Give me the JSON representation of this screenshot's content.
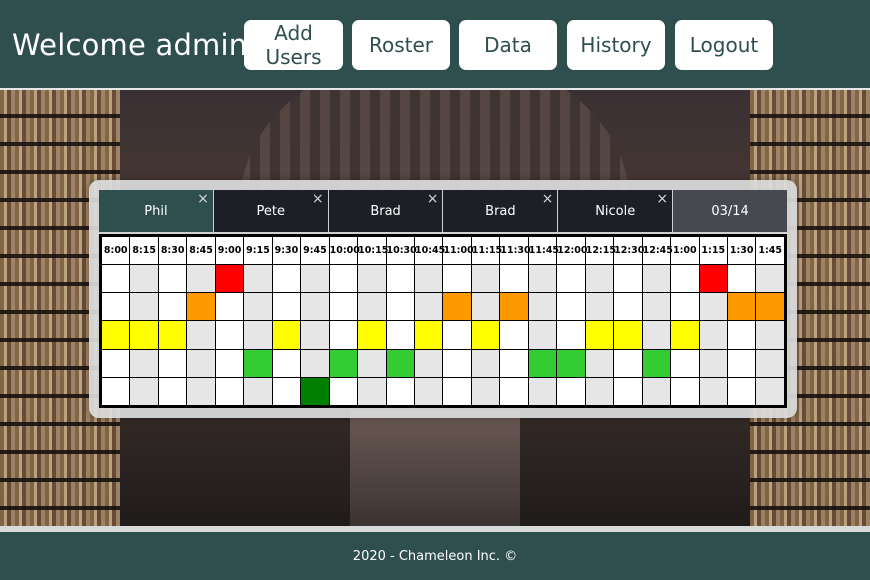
{
  "header": {
    "welcome": "Welcome admin!",
    "nav": [
      "Add Users",
      "Roster",
      "Data",
      "History",
      "Logout"
    ]
  },
  "tabs": [
    {
      "label": "Phil",
      "close": "×",
      "active": true
    },
    {
      "label": "Pete",
      "close": "×",
      "active": false
    },
    {
      "label": "Brad",
      "close": "×",
      "active": false
    },
    {
      "label": "Brad",
      "close": "×",
      "active": false
    },
    {
      "label": "Nicole",
      "close": "×",
      "active": false
    }
  ],
  "date_tab": "03/14",
  "times": [
    "8:00",
    "8:15",
    "8:30",
    "8:45",
    "9:00",
    "9:15",
    "9:30",
    "9:45",
    "10:00",
    "10:15",
    "10:30",
    "10:45",
    "11:00",
    "11:15",
    "11:30",
    "11:45",
    "12:00",
    "12:15",
    "12:30",
    "12:45",
    "1:00",
    "1:15",
    "1:30",
    "1:45"
  ],
  "colors": {
    "red": "#ff0000",
    "orange": "#ff9900",
    "yellow": "#ffff00",
    "green": "#33cc33",
    "dark_green": "#008000",
    "empty": "#ffffff",
    "empty_alt": "#e6e6e6"
  },
  "grid_rows": [
    [
      "W",
      "A",
      "W",
      "A",
      "R",
      "A",
      "W",
      "A",
      "W",
      "A",
      "W",
      "A",
      "W",
      "A",
      "W",
      "A",
      "W",
      "A",
      "W",
      "A",
      "W",
      "R",
      "W",
      "A"
    ],
    [
      "W",
      "A",
      "W",
      "O",
      "W",
      "A",
      "W",
      "A",
      "W",
      "A",
      "W",
      "A",
      "O",
      "A",
      "O",
      "A",
      "W",
      "A",
      "W",
      "A",
      "W",
      "A",
      "O",
      "O"
    ],
    [
      "Y",
      "Y",
      "Y",
      "A",
      "W",
      "A",
      "Y",
      "A",
      "W",
      "Y",
      "W",
      "Y",
      "W",
      "Y",
      "W",
      "A",
      "W",
      "Y",
      "Y",
      "A",
      "Y",
      "A",
      "W",
      "A"
    ],
    [
      "W",
      "A",
      "W",
      "A",
      "W",
      "G",
      "W",
      "A",
      "G",
      "A",
      "G",
      "A",
      "W",
      "A",
      "W",
      "G",
      "G",
      "A",
      "W",
      "G",
      "W",
      "A",
      "W",
      "A"
    ],
    [
      "W",
      "A",
      "W",
      "A",
      "W",
      "A",
      "W",
      "D",
      "W",
      "A",
      "W",
      "A",
      "W",
      "A",
      "W",
      "A",
      "W",
      "A",
      "W",
      "A",
      "W",
      "A",
      "W",
      "A"
    ]
  ],
  "footer": "2020 - Chameleon Inc. ©"
}
